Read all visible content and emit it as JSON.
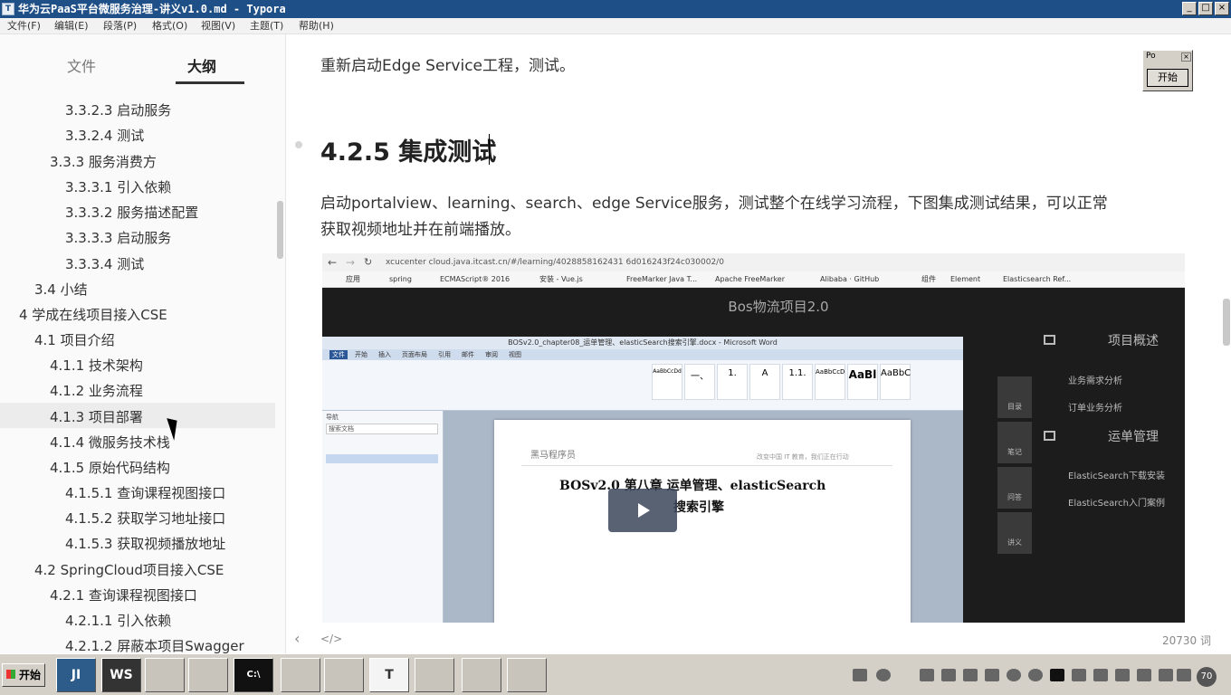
{
  "window": {
    "title": "华为云PaaS平台微服务治理-讲义v1.0.md - Typora",
    "minimize": "_",
    "maximize": "□",
    "close": "×"
  },
  "menu": [
    "文件(F)",
    "编辑(E)",
    "段落(P)",
    "格式(O)",
    "视图(V)",
    "主题(T)",
    "帮助(H)"
  ],
  "sidebar": {
    "tabs": {
      "files": "文件",
      "outline": "大纲"
    },
    "outline": [
      "3.3.2.3 启动服务",
      "3.3.2.4 测试",
      "3.3.3 服务消费方",
      "3.3.3.1 引入依赖",
      "3.3.3.2 服务描述配置",
      "3.3.3.3 启动服务",
      "3.3.3.4 测试",
      "3.4 小结",
      "4 学成在线项目接入CSE",
      "4.1 项目介绍",
      "4.1.1 技术架构",
      "4.1.2 业务流程",
      "4.1.3 项目部署",
      "4.1.4 微服务技术栈",
      "4.1.5 原始代码结构",
      "4.1.5.1 查询课程视图接口",
      "4.1.5.2 获取学习地址接口",
      "4.1.5.3 获取视频播放地址",
      "4.2 SpringCloud项目接入CSE",
      "4.2.1 查询课程视图接口",
      "4.2.1.1 引入依赖",
      "4.2.1.2 屏蔽本项目Swagger"
    ]
  },
  "editor": {
    "para_top": "重新启动Edge Service工程，测试。",
    "heading": "4.2.5 集成测试",
    "para_line1": "启动portalview、learning、search、edge Service服务，测试整个在线学习流程，下图集成测试结果，可以正常",
    "para_line2": "获取视频地址并在前端播放。"
  },
  "embedded": {
    "url": "xcucenter cloud.java.itcast.cn/#/learning/4028858162431 6d016243f24c030002/0",
    "bookmarks": [
      "应用",
      "spring",
      "ECMAScript® 2016",
      "安装 - Vue.js",
      "FreeMarker Java T...",
      "Apache FreeMarker",
      "Alibaba · GitHub",
      "组件",
      "Element",
      "Elasticsearch Ref..."
    ],
    "site_title": "Bos物流项目2.0",
    "right_headings": [
      "项目概述",
      "运单管理"
    ],
    "right_items": [
      "业务需求分析",
      "订单业务分析",
      "ElasticSearch下载安装",
      "ElasticSearch入门案例"
    ],
    "nav_tiles": [
      "目录",
      "笔记",
      "问答",
      "讲义"
    ],
    "word_title": "BOSv2.0_chapter08_运单管理、elasticSearch搜索引擎.docx - Microsoft Word",
    "word_tabs": [
      "文件",
      "开始",
      "插入",
      "页面布局",
      "引用",
      "邮件",
      "审阅",
      "视图"
    ],
    "word_styles": [
      "AaBbCcDd",
      "一、",
      "1.",
      "A",
      "1.1.",
      "AaBbCcD",
      "AaBl",
      "AaBbC"
    ],
    "word_nav_label": "导航",
    "word_nav_search": "搜索文档",
    "doc_title_line1": "BOSv2.0  第八章  运单管理、elasticSearch",
    "doc_title_line2": "搜索引擎",
    "doc_header_right": "改变中国 IT 教育，我们正在行动",
    "doc_logo": "黑马程序员"
  },
  "status": {
    "source_toggle": "</>",
    "word_count": "20730 词"
  },
  "popup": {
    "title": "Po",
    "close": "×",
    "button": "开始"
  },
  "taskbar": {
    "start": "开始",
    "apps": [
      "JI",
      "WS",
      "",
      "",
      "C:\\",
      "",
      "",
      "T",
      "",
      "",
      ""
    ],
    "clock": "70"
  }
}
